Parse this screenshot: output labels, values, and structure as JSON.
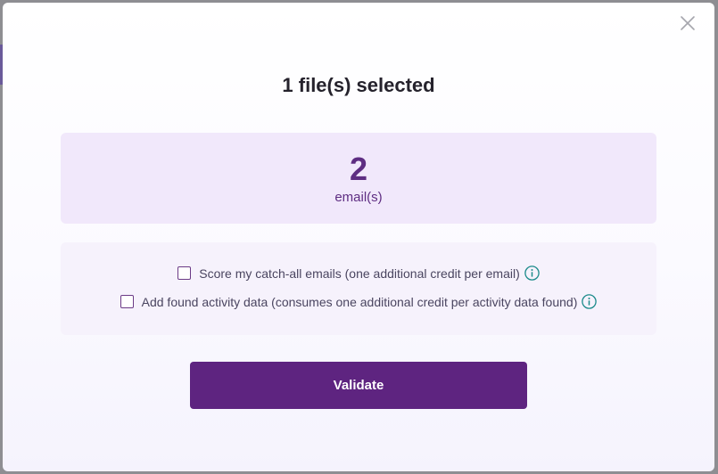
{
  "modal": {
    "title": "1 file(s) selected",
    "close_icon": "close-icon"
  },
  "summary": {
    "count": "2",
    "unit_label": "email(s)"
  },
  "options": [
    {
      "label": "Score my catch-all emails (one additional credit per email)",
      "checked": false,
      "info_icon": "info-icon"
    },
    {
      "label": "Add found activity data (consumes one additional credit per activity data found)",
      "checked": false,
      "info_icon": "info-icon"
    }
  ],
  "actions": {
    "validate_label": "Validate"
  },
  "colors": {
    "accent": "#5e2480",
    "count_box_bg": "#f1e8fb",
    "info_icon": "#1a8a8a"
  }
}
